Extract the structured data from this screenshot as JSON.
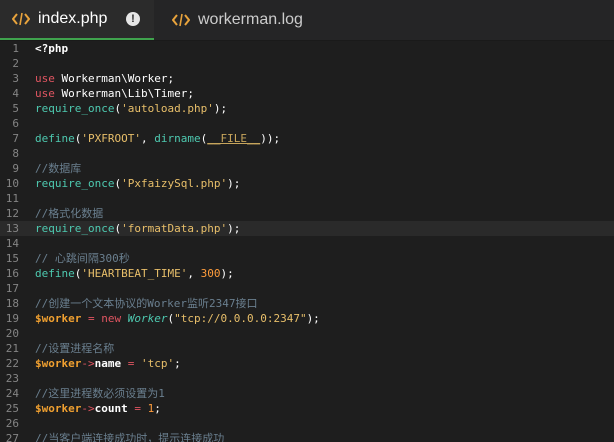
{
  "tabs": [
    {
      "label": "index.php",
      "active": true,
      "icon": "code-icon",
      "status": "unsaved-dot"
    },
    {
      "label": "workerman.log",
      "active": false,
      "icon": "code-icon"
    }
  ],
  "colors": {
    "accent_tab": "#3fa34d",
    "keyword": "#e05561",
    "function": "#4ec9b0",
    "string": "#e8bf6a",
    "comment": "#6a7f8f",
    "variable": "#f0a030"
  },
  "editor": {
    "current_line": 13,
    "lines": [
      {
        "n": "1",
        "t": [
          [
            "plainb",
            "<?php"
          ]
        ]
      },
      {
        "n": "2",
        "t": []
      },
      {
        "n": "3",
        "t": [
          [
            "kw",
            "use"
          ],
          [
            "plain",
            " Workerman\\Worker;"
          ]
        ]
      },
      {
        "n": "4",
        "t": [
          [
            "kw",
            "use"
          ],
          [
            "plain",
            " Workerman\\Lib\\Timer;"
          ]
        ]
      },
      {
        "n": "5",
        "t": [
          [
            "fn",
            "require_once"
          ],
          [
            "plain",
            "("
          ],
          [
            "str",
            "'autoload.php'"
          ],
          [
            "plain",
            ");"
          ]
        ]
      },
      {
        "n": "6",
        "t": []
      },
      {
        "n": "7",
        "t": [
          [
            "fn",
            "define"
          ],
          [
            "plain",
            "("
          ],
          [
            "str",
            "'PXFROOT'"
          ],
          [
            "plain",
            ", "
          ],
          [
            "fn",
            "dirname"
          ],
          [
            "plain",
            "("
          ],
          [
            "const",
            "__FILE__"
          ],
          [
            "plain",
            "));"
          ]
        ]
      },
      {
        "n": "8",
        "t": []
      },
      {
        "n": "9",
        "t": [
          [
            "cm",
            "//数据库"
          ]
        ]
      },
      {
        "n": "10",
        "t": [
          [
            "fn",
            "require_once"
          ],
          [
            "plain",
            "("
          ],
          [
            "str",
            "'PxfaizySql.php'"
          ],
          [
            "plain",
            ");"
          ]
        ]
      },
      {
        "n": "11",
        "t": []
      },
      {
        "n": "12",
        "t": [
          [
            "cm",
            "//格式化数据"
          ]
        ]
      },
      {
        "n": "13",
        "t": [
          [
            "fn",
            "require_once"
          ],
          [
            "plain",
            "("
          ],
          [
            "str",
            "'formatData.php'"
          ],
          [
            "plain",
            ");"
          ]
        ]
      },
      {
        "n": "14",
        "t": []
      },
      {
        "n": "15",
        "t": [
          [
            "cm",
            "// 心跳间隔300秒"
          ]
        ]
      },
      {
        "n": "16",
        "t": [
          [
            "fn",
            "define"
          ],
          [
            "plain",
            "("
          ],
          [
            "str",
            "'HEARTBEAT_TIME'"
          ],
          [
            "plain",
            ", "
          ],
          [
            "num",
            "300"
          ],
          [
            "plain",
            ");"
          ]
        ]
      },
      {
        "n": "17",
        "t": []
      },
      {
        "n": "18",
        "t": [
          [
            "cm",
            "//创建一个文本协议的Worker监听2347接口"
          ]
        ]
      },
      {
        "n": "19",
        "t": [
          [
            "var",
            "$worker"
          ],
          [
            "op",
            " = "
          ],
          [
            "kw",
            "new "
          ],
          [
            "cls",
            "Worker"
          ],
          [
            "plain",
            "("
          ],
          [
            "str",
            "\"tcp://0.0.0.0:2347\""
          ],
          [
            "plain",
            ");"
          ]
        ]
      },
      {
        "n": "20",
        "t": []
      },
      {
        "n": "21",
        "t": [
          [
            "cm",
            "//设置进程名称"
          ]
        ]
      },
      {
        "n": "22",
        "t": [
          [
            "var",
            "$worker"
          ],
          [
            "op",
            "->"
          ],
          [
            "plainb",
            "name"
          ],
          [
            "op",
            " = "
          ],
          [
            "str",
            "'tcp'"
          ],
          [
            "plain",
            ";"
          ]
        ]
      },
      {
        "n": "23",
        "t": []
      },
      {
        "n": "24",
        "t": [
          [
            "cm",
            "//这里进程数必须设置为1"
          ]
        ]
      },
      {
        "n": "25",
        "t": [
          [
            "var",
            "$worker"
          ],
          [
            "op",
            "->"
          ],
          [
            "plainb",
            "count"
          ],
          [
            "op",
            " = "
          ],
          [
            "num",
            "1"
          ],
          [
            "plain",
            ";"
          ]
        ]
      },
      {
        "n": "26",
        "t": []
      },
      {
        "n": "27",
        "t": [
          [
            "cm",
            "//当客户端连接成功时，提示连接成功"
          ]
        ]
      }
    ]
  }
}
